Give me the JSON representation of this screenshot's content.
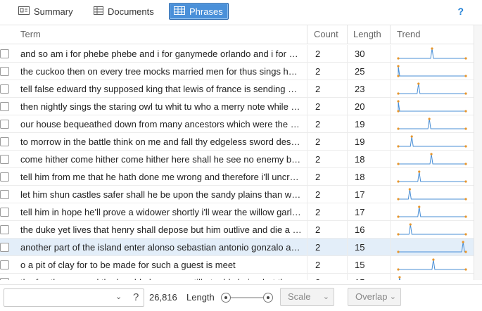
{
  "tabs": [
    {
      "label": "Summary",
      "icon": "summary-icon",
      "active": false
    },
    {
      "label": "Documents",
      "icon": "documents-icon",
      "active": false
    },
    {
      "label": "Phrases",
      "icon": "phrases-icon",
      "active": true
    }
  ],
  "help_label": "?",
  "columns": [
    "Term",
    "Count",
    "Length",
    "Trend"
  ],
  "rows": [
    {
      "term": "and so am i for phebe phebe and i for ganymede orlando and i for nothing",
      "count": "2",
      "length": "30",
      "trend_peak": 0.5
    },
    {
      "term": "the cuckoo then on every tree mocks married men for thus sings he cuckoo",
      "count": "2",
      "length": "25",
      "trend_peak": 0.0
    },
    {
      "term": "tell false edward thy supposed king that lewis of france is sending over",
      "count": "2",
      "length": "23",
      "trend_peak": 0.3
    },
    {
      "term": "then nightly sings the staring owl tu whit tu who a merry note while greasy",
      "count": "2",
      "length": "20",
      "trend_peak": 0.0
    },
    {
      "term": "our house bequeathed down from many ancestors which were the greatest",
      "count": "2",
      "length": "19",
      "trend_peak": 0.46
    },
    {
      "term": "to morrow in the battle think on me and fall thy edgeless sword despair",
      "count": "2",
      "length": "19",
      "trend_peak": 0.2
    },
    {
      "term": "come hither come hither come hither here shall he see no enemy but winter",
      "count": "2",
      "length": "18",
      "trend_peak": 0.49
    },
    {
      "term": "tell him from me that he hath done me wrong and therefore i'll uncrown him",
      "count": "2",
      "length": "18",
      "trend_peak": 0.31
    },
    {
      "term": "let him shun castles safer shall he be upon the sandy plains than where",
      "count": "2",
      "length": "17",
      "trend_peak": 0.17
    },
    {
      "term": "tell him in hope he'll prove a widower shortly i'll wear the willow garland",
      "count": "2",
      "length": "17",
      "trend_peak": 0.31
    },
    {
      "term": "the duke yet lives that henry shall depose but him outlive and die a violent",
      "count": "2",
      "length": "16",
      "trend_peak": 0.18
    },
    {
      "term": "another part of the island enter alonso sebastian antonio gonzalo adrian",
      "count": "2",
      "length": "15",
      "trend_peak": 0.96
    },
    {
      "term": "o a pit of clay for to be made for such a guest is meet",
      "count": "2",
      "length": "15",
      "trend_peak": 0.52
    },
    {
      "term": "the fox the ape and the humble bee were still at odds being but three",
      "count": "2",
      "length": "15",
      "trend_peak": 0.02
    }
  ],
  "selected_row": 11,
  "footer": {
    "total": "26,816",
    "length_label": "Length",
    "scale_label": "Scale",
    "overlap_label": "Overlap",
    "select_help": "?"
  },
  "colors": {
    "accent": "#4a90d9",
    "trend_line": "#4a8fd6",
    "trend_point": "#e8962b",
    "help": "#1e7fd6"
  }
}
